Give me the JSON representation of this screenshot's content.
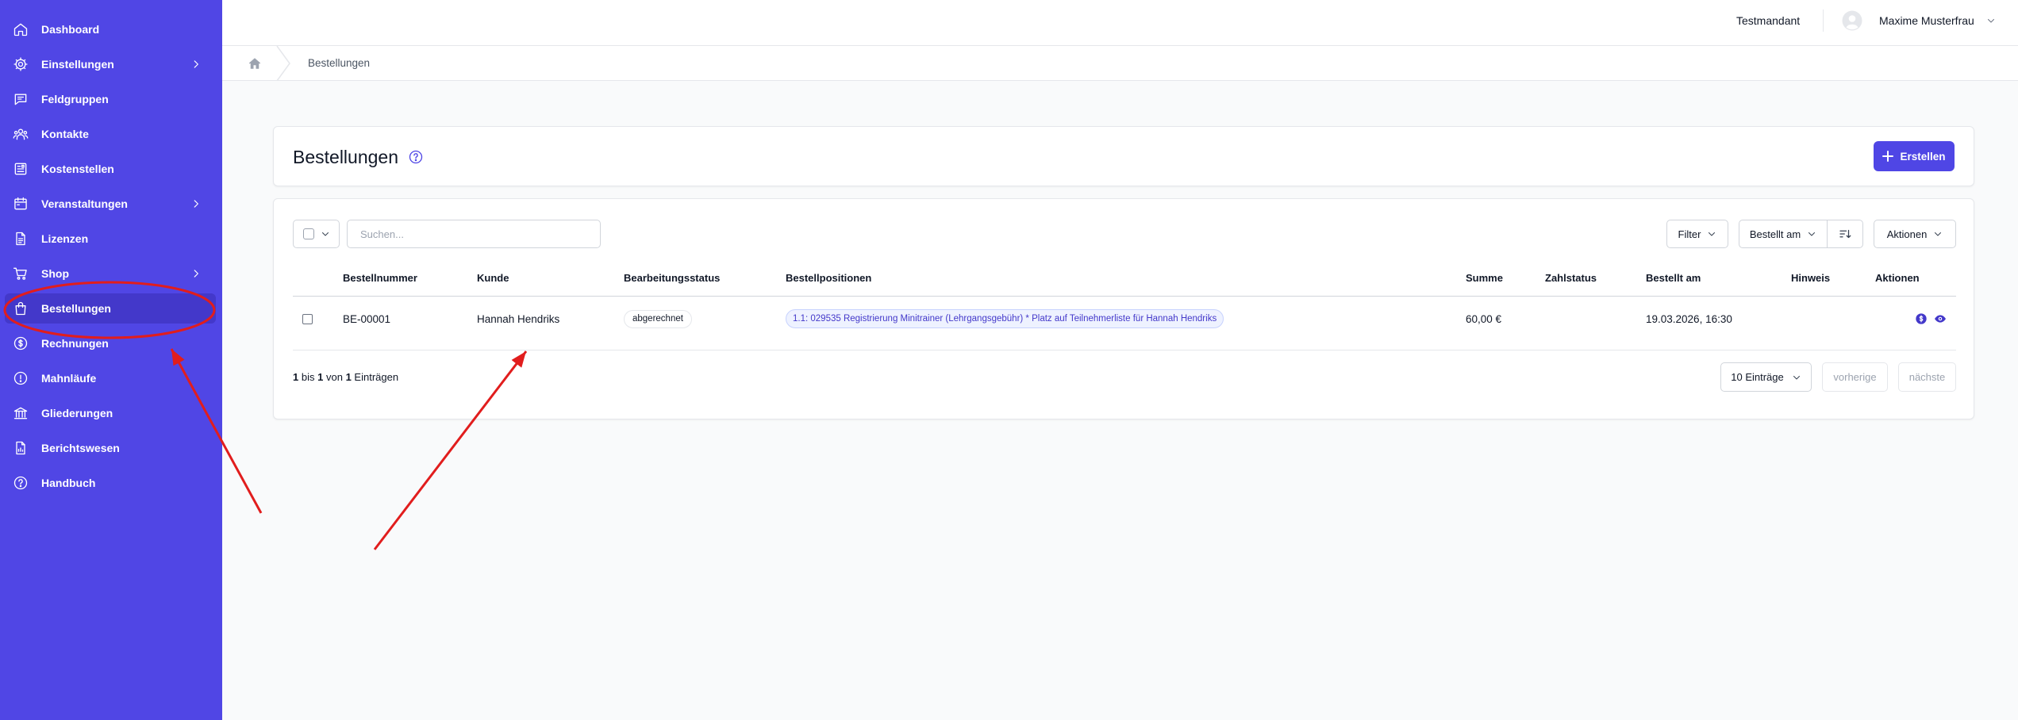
{
  "sidebar": {
    "items": [
      {
        "label": "Dashboard",
        "icon": "home-icon",
        "has_submenu": false,
        "active": false
      },
      {
        "label": "Einstellungen",
        "icon": "gear-icon",
        "has_submenu": true,
        "active": false
      },
      {
        "label": "Feldgruppen",
        "icon": "chat-icon",
        "has_submenu": false,
        "active": false
      },
      {
        "label": "Kontakte",
        "icon": "users-icon",
        "has_submenu": false,
        "active": false
      },
      {
        "label": "Kostenstellen",
        "icon": "ledger-icon",
        "has_submenu": false,
        "active": false
      },
      {
        "label": "Veranstaltungen",
        "icon": "calendar-icon",
        "has_submenu": true,
        "active": false
      },
      {
        "label": "Lizenzen",
        "icon": "document-icon",
        "has_submenu": false,
        "active": false
      },
      {
        "label": "Shop",
        "icon": "cart-icon",
        "has_submenu": true,
        "active": false
      },
      {
        "label": "Bestellungen",
        "icon": "shopping-bag-icon",
        "has_submenu": false,
        "active": true
      },
      {
        "label": "Rechnungen",
        "icon": "currency-icon",
        "has_submenu": false,
        "active": false
      },
      {
        "label": "Mahnläufe",
        "icon": "exclamation-circle-icon",
        "has_submenu": false,
        "active": false
      },
      {
        "label": "Gliederungen",
        "icon": "building-icon",
        "has_submenu": false,
        "active": false
      },
      {
        "label": "Berichtswesen",
        "icon": "report-icon",
        "has_submenu": false,
        "active": false
      },
      {
        "label": "Handbuch",
        "icon": "question-circle-icon",
        "has_submenu": false,
        "active": false
      }
    ]
  },
  "header": {
    "tenant": "Testmandant",
    "user_name": "Maxime Musterfrau"
  },
  "breadcrumb": {
    "current": "Bestellungen"
  },
  "page": {
    "title": "Bestellungen",
    "create_label": "Erstellen"
  },
  "toolbar": {
    "search_placeholder": "Suchen...",
    "search_value": "",
    "filter_label": "Filter",
    "sort_label": "Bestellt am",
    "actions_label": "Aktionen"
  },
  "table": {
    "columns": [
      "Bestellnummer",
      "Kunde",
      "Bearbeitungsstatus",
      "Bestellpositionen",
      "Summe",
      "Zahlstatus",
      "Bestellt am",
      "Hinweis",
      "Aktionen"
    ],
    "rows": [
      {
        "order_number": "BE-00001",
        "customer": "Hannah Hendriks",
        "status": "abgerechnet",
        "positions": [
          "1.1: 029535 Registrierung Minitrainer (Lehrgangsgebühr) * Platz auf Teilnehmerliste für Hannah Hendriks"
        ],
        "sum": "60,00 €",
        "payment_status": "",
        "ordered_at": "19.03.2026, 16:30",
        "note": "",
        "actions": [
          "currency-icon",
          "eye-icon"
        ]
      }
    ]
  },
  "footer": {
    "from": "1",
    "word_to": "bis",
    "to": "1",
    "word_of": "von",
    "total": "1",
    "word_entries": "Einträgen",
    "page_size": "10 Einträge",
    "prev_label": "vorherige",
    "next_label": "nächste"
  },
  "colors": {
    "sidebar": "#5046e5",
    "sidebar_active": "#4338ca",
    "accent": "#4f46e5",
    "annotation": "#e11d1d"
  }
}
